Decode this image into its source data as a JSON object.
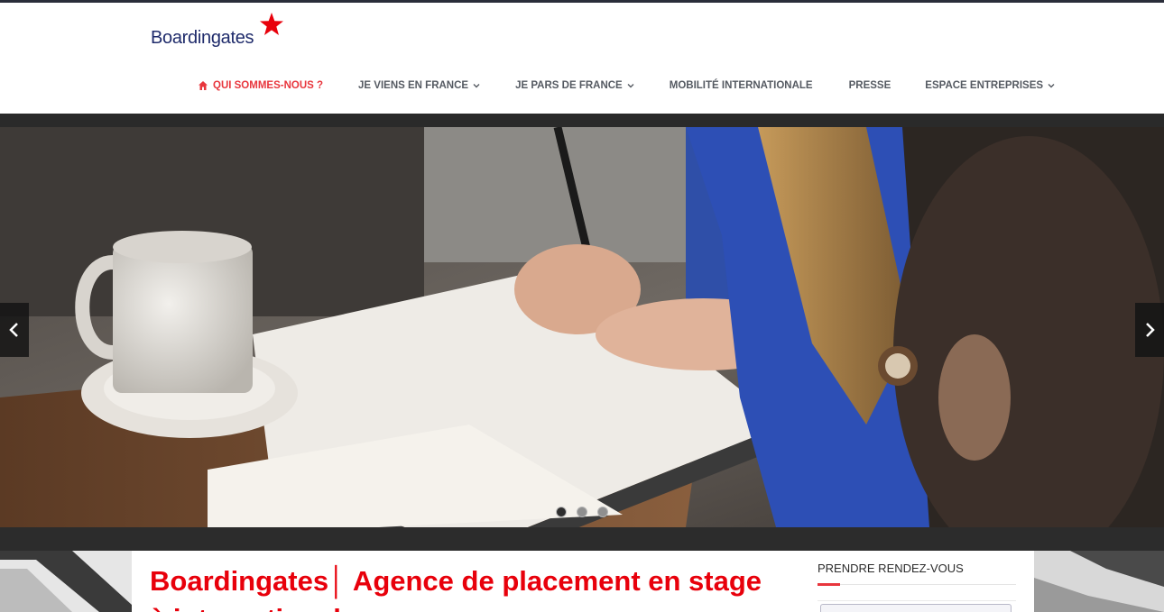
{
  "brand": {
    "name": "Boardingates",
    "accent_color": "#e8363d",
    "logo_text_color": "#1f2b6b",
    "star_color": "#e8000b",
    "logo_icon": "star-icon"
  },
  "nav": {
    "items": [
      {
        "label": "QUI SOMMES-NOUS ?",
        "icon": "home-icon",
        "active": true,
        "has_dropdown": false
      },
      {
        "label": "JE VIENS EN FRANCE",
        "active": false,
        "has_dropdown": true
      },
      {
        "label": "JE PARS DE FRANCE",
        "active": false,
        "has_dropdown": true
      },
      {
        "label": "MOBILITÉ INTERNATIONALE",
        "active": false,
        "has_dropdown": false
      },
      {
        "label": "PRESSE",
        "active": false,
        "has_dropdown": false
      },
      {
        "label": "ESPACE ENTREPRISES",
        "active": false,
        "has_dropdown": true
      }
    ]
  },
  "slider": {
    "prev_icon": "chevron-left-icon",
    "next_icon": "chevron-right-icon",
    "slide_count": 3,
    "active_slide": 1
  },
  "main": {
    "title": "Boardingates│ Agence de placement en stage à international"
  },
  "sidebar": {
    "title": "PRENDRE RENDEZ-VOUS"
  }
}
